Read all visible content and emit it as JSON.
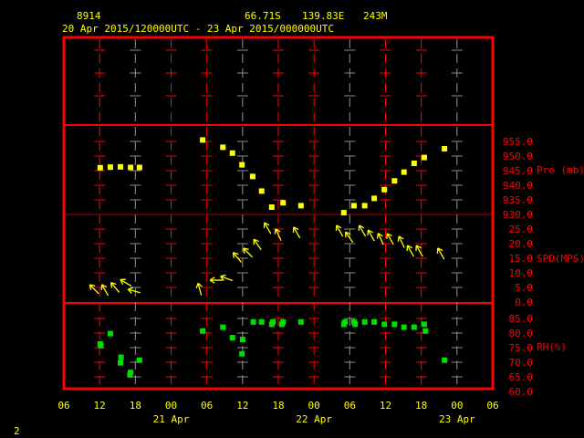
{
  "header": {
    "station": "8914",
    "latitude": "66.71S",
    "longitude": "139.83E",
    "elevation": "243M",
    "period": "20 Apr 2015/120000UTC - 23 Apr 2015/000000UTC"
  },
  "page_number": "2",
  "colors": {
    "frame": "#ff0000",
    "grid_alt": "#8c8c8c",
    "pressure": "#ffff00",
    "wind": "#ffff00",
    "rh": "#00e000",
    "text": "#ffff00"
  },
  "chart_data": [
    {
      "type": "scatter",
      "title": "Pre (mb)",
      "ylabel": "Pre (mb)",
      "ylim": [
        930,
        960
      ],
      "yticks": [
        "955.0",
        "950.0",
        "945.0",
        "940.0",
        "935.0",
        "930.0"
      ],
      "x_unit": "hours since 20 Apr 06UTC",
      "x": [
        6.1,
        7.8,
        9.5,
        11.2,
        12.7,
        23.3,
        26.7,
        28.3,
        29.9,
        31.7,
        33.2,
        34.9,
        36.8,
        39.8,
        47.0,
        48.7,
        50.5,
        52.1,
        53.8,
        55.5,
        57.1,
        58.8,
        60.5,
        63.9
      ],
      "values": [
        946,
        946.2,
        946.3,
        946.1,
        946.1,
        955.5,
        953,
        951,
        947,
        943,
        938,
        932.5,
        934,
        933,
        930.6,
        933,
        933,
        935.5,
        938.5,
        941.5,
        944.5,
        947.5,
        949.5,
        952.5
      ]
    },
    {
      "type": "scatter",
      "title": "SPD(MPS)",
      "ylabel": "SPD(MPS)",
      "ylim": [
        0,
        30
      ],
      "yticks": [
        "25.0",
        "20.0",
        "15.0",
        "10.0",
        "5.0",
        "0.0"
      ],
      "x_unit": "hours since 20 Apr 06UTC",
      "x": [
        5.1,
        6.9,
        8.6,
        10.4,
        11.8,
        22.8,
        25.6,
        27.3,
        29.1,
        30.9,
        32.5,
        34.2,
        36.0,
        39.1,
        46.3,
        47.9,
        50.1,
        51.6,
        53.2,
        54.8,
        56.7,
        58.2,
        59.7,
        63.3
      ],
      "values": [
        4.7,
        4.4,
        5.3,
        6.9,
        4.1,
        4.7,
        7.8,
        8.4,
        15.6,
        17.2,
        20,
        25.6,
        23.4,
        24.1,
        24.7,
        22.5,
        24.7,
        23.1,
        21.9,
        21.9,
        20.9,
        17.8,
        17.8,
        16.9
      ],
      "arrow_dir_deg": [
        315,
        330,
        320,
        300,
        285,
        345,
        270,
        290,
        320,
        315,
        325,
        330,
        335,
        330,
        330,
        325,
        330,
        330,
        335,
        330,
        335,
        330,
        330,
        330
      ]
    },
    {
      "type": "scatter",
      "title": "RH(%)",
      "ylabel": "RH(%)",
      "ylim": [
        60,
        88
      ],
      "yticks": [
        "85.0",
        "80.0",
        "75.0",
        "70.0",
        "65.0",
        "60.0"
      ],
      "x_unit": "hours since 20 Apr 06UTC",
      "x": [
        6.1,
        6.2,
        7.8,
        9.6,
        9.5,
        11.2,
        11.1,
        12.7,
        23.3,
        26.7,
        28.3,
        30.0,
        29.9,
        31.8,
        33.2,
        34.9,
        35.1,
        36.8,
        36.6,
        39.8,
        47.0,
        47.2,
        48.7,
        48.9,
        50.5,
        52.1,
        53.8,
        55.5,
        57.1,
        58.8,
        60.5,
        60.7,
        63.9
      ],
      "values": [
        76.3,
        75.7,
        79.8,
        71.7,
        69.8,
        66.5,
        65.7,
        70.7,
        80.7,
        82,
        78.4,
        77.8,
        72.9,
        83.8,
        83.8,
        83,
        83.8,
        83.8,
        83,
        83.8,
        83,
        83.8,
        83.8,
        83,
        83.8,
        83.8,
        83,
        83,
        82,
        82,
        83,
        80.7,
        70.7
      ]
    },
    {
      "type": "axis",
      "x_ticks": [
        "06",
        "12",
        "18",
        "00",
        "06",
        "12",
        "18",
        "00",
        "06",
        "12",
        "18",
        "00",
        "06"
      ],
      "x_dates": [
        "21 Apr",
        "22 Apr",
        "23 Apr"
      ]
    }
  ]
}
